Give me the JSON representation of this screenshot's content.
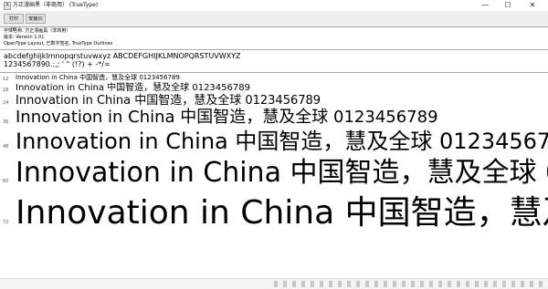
{
  "window": {
    "title": "方正漫画黑（非商用） (TrueType)",
    "icon": "font-file-icon",
    "controls": {
      "minimize": "—",
      "maximize": "☐",
      "close": "✕"
    }
  },
  "toolbar": {
    "print_label": "打印(P)",
    "install_label": "安装(I)"
  },
  "info": {
    "font_name": "字体名称: 方正漫画黑（非商用）",
    "version": "版本: Version 1.01",
    "features": "OpenType Layout, 已数字签名, TrueType Outlines"
  },
  "samples": {
    "lower": "abcdefghijklmnopqrstuvwxyz ABCDEFGHIJKLMNOPQRSTUVWXYZ",
    "digits": "1234567890.:,; ' \" (!?) + -*/="
  },
  "preview": {
    "text": "Innovation in China 中国智造，慧及全球 0123456789",
    "sizes": [
      "12",
      "18",
      "24",
      "36",
      "48",
      "60",
      "72"
    ]
  }
}
